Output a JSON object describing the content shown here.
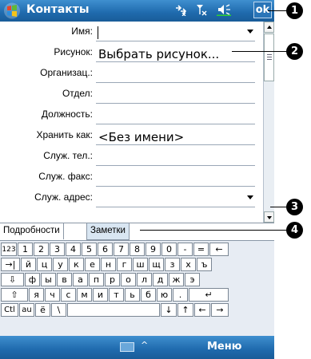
{
  "titlebar": {
    "title": "Контакты",
    "ok_label": "ok"
  },
  "form": {
    "rows": [
      {
        "label": "Имя:",
        "value": ""
      },
      {
        "label": "Рисунок:",
        "value": "Выбрать рисунок..."
      },
      {
        "label": "Организац.:",
        "value": ""
      },
      {
        "label": "Отдел:",
        "value": ""
      },
      {
        "label": "Должность:",
        "value": ""
      },
      {
        "label": "Хранить как:",
        "value": "<Без имени>"
      },
      {
        "label": "Служ. тел.:",
        "value": ""
      },
      {
        "label": "Служ. факс:",
        "value": ""
      },
      {
        "label": "Служ. адрес:",
        "value": ""
      }
    ]
  },
  "tabs": [
    {
      "label": "Подробности"
    },
    {
      "label": "Заметки"
    }
  ],
  "keyboard": {
    "rows": [
      [
        "123",
        "1",
        "2",
        "3",
        "4",
        "5",
        "6",
        "7",
        "8",
        "9",
        "0",
        "-",
        "=",
        "←"
      ],
      [
        "→|",
        "й",
        "ц",
        "у",
        "к",
        "е",
        "н",
        "г",
        "ш",
        "щ",
        "з",
        "х",
        "ъ"
      ],
      [
        "⇩",
        "ф",
        "ы",
        "в",
        "а",
        "п",
        "р",
        "о",
        "л",
        "д",
        "ж",
        "э"
      ],
      [
        "⇧",
        "я",
        "ч",
        "с",
        "м",
        "и",
        "т",
        "ь",
        "б",
        "ю",
        ".",
        "↵"
      ],
      [
        "Ctl",
        "au",
        "ё",
        "\\",
        " ",
        "↓",
        "↑",
        "←",
        "→"
      ]
    ]
  },
  "menubar": {
    "caret": "^",
    "menu_label": "Меню"
  },
  "callouts": [
    "1",
    "2",
    "3",
    "4"
  ],
  "colors": {
    "titlebar": "#1f6aad",
    "keyboard_bg": "#e7ecf3"
  }
}
